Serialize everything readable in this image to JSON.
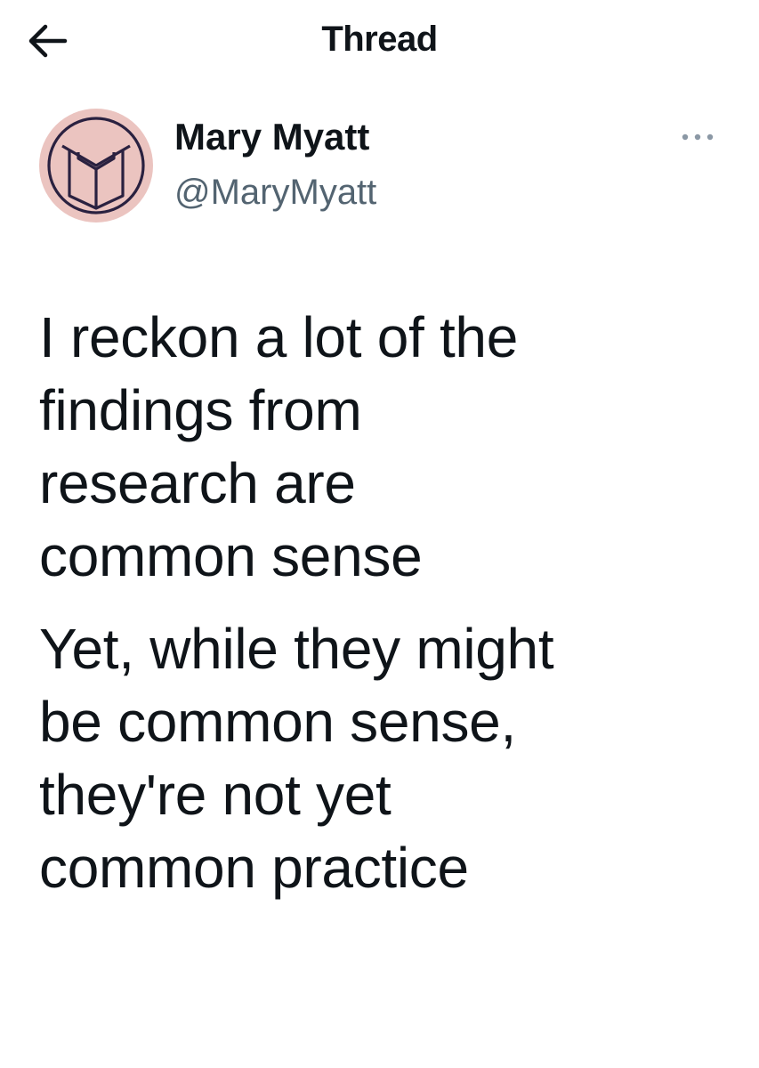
{
  "header": {
    "back_icon": "arrow-left-icon",
    "title": "Thread"
  },
  "author": {
    "avatar_icon": "open-book-logo-icon",
    "avatar_bg": "#ebc4c0",
    "display_name": "Mary Myatt",
    "handle": "@MaryMyatt",
    "more_icon": "more-dots-icon"
  },
  "tweet": {
    "paragraphs": [
      "I reckon a lot of the\nfindings from\nresearch are\ncommon sense",
      "Yet, while they might\nbe common sense,\nthey're not yet\ncommon practice"
    ]
  },
  "colors": {
    "text": "#0f1419",
    "secondary": "#536471",
    "accent": "#1d9bf0"
  }
}
